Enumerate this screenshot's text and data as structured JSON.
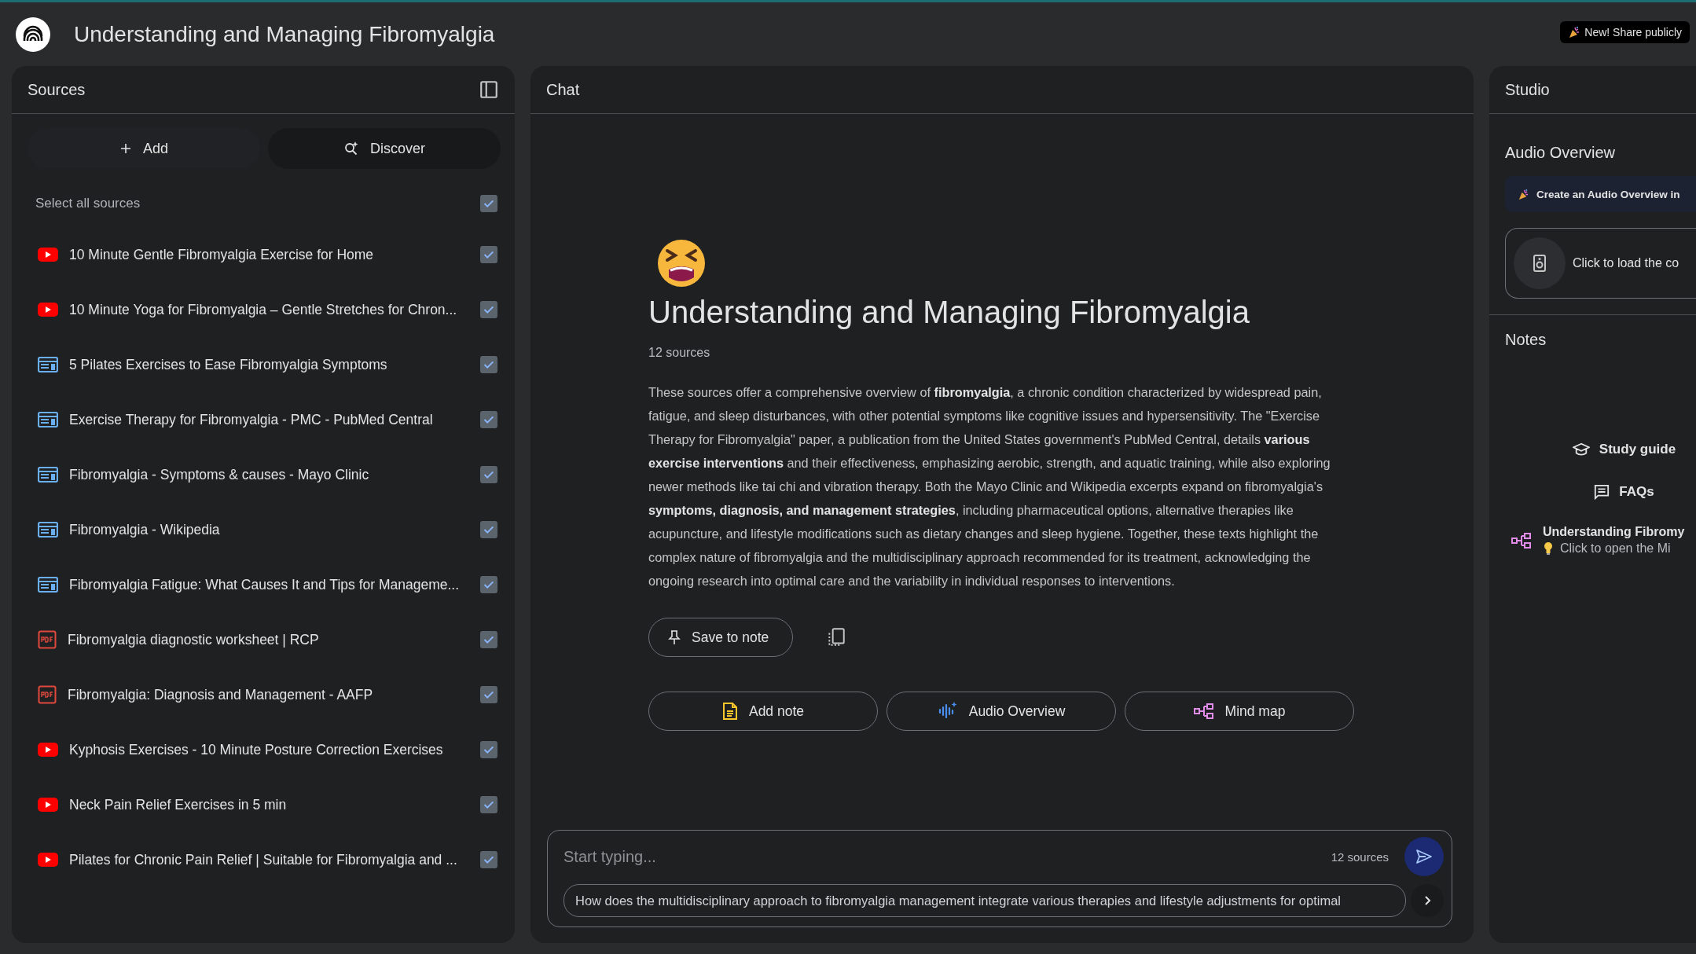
{
  "app": {
    "title": "Understanding and Managing Fibromyalgia",
    "share_button": "New! Share publicly"
  },
  "sources": {
    "title": "Sources",
    "add_button": "Add",
    "discover_button": "Discover",
    "select_all": {
      "label": "Select all sources",
      "checked": true
    },
    "items": [
      {
        "kind": "youtube",
        "title": "10 Minute Gentle Fibromyalgia Exercise for Home",
        "checked": true
      },
      {
        "kind": "youtube",
        "title": "10 Minute Yoga for Fibromyalgia – Gentle Stretches for Chron...",
        "checked": true
      },
      {
        "kind": "web",
        "title": "5 Pilates Exercises to Ease Fibromyalgia Symptoms",
        "checked": true
      },
      {
        "kind": "web",
        "title": "Exercise Therapy for Fibromyalgia - PMC - PubMed Central",
        "checked": true
      },
      {
        "kind": "web",
        "title": "Fibromyalgia - Symptoms & causes - Mayo Clinic",
        "checked": true
      },
      {
        "kind": "web",
        "title": "Fibromyalgia - Wikipedia",
        "checked": true
      },
      {
        "kind": "web",
        "title": "Fibromyalgia Fatigue: What Causes It and Tips for Manageme...",
        "checked": true
      },
      {
        "kind": "pdf",
        "title": "Fibromyalgia diagnostic worksheet | RCP",
        "checked": true
      },
      {
        "kind": "pdf",
        "title": "Fibromyalgia: Diagnosis and Management - AAFP",
        "checked": true
      },
      {
        "kind": "youtube",
        "title": "Kyphosis Exercises - 10 Minute Posture Correction Exercises",
        "checked": true
      },
      {
        "kind": "youtube",
        "title": "Neck Pain Relief Exercises in 5 min",
        "checked": true
      },
      {
        "kind": "youtube",
        "title": "Pilates for Chronic Pain Relief | Suitable for Fibromyalgia and ...",
        "checked": true
      }
    ]
  },
  "chat": {
    "title": "Chat",
    "notebook": {
      "title": "Understanding and Managing Fibromyalgia",
      "source_count": "12 sources",
      "summary": "These sources offer a comprehensive overview of **fibromyalgia**, a chronic condition characterized by widespread pain, fatigue, and sleep disturbances, with other potential symptoms like cognitive issues and hypersensitivity. The \"Exercise Therapy for Fibromyalgia\" paper, a publication from the United States government's PubMed Central, details **various exercise interventions** and their effectiveness, emphasizing aerobic, strength, and aquatic training, while also exploring newer methods like tai chi and vibration therapy. Both the Mayo Clinic and Wikipedia excerpts expand on fibromyalgia's **symptoms, diagnosis, and management strategies**, including pharmaceutical options, alternative therapies like acupuncture, and lifestyle modifications such as dietary changes and sleep hygiene. Together, these texts highlight the complex nature of fibromyalgia and the multidisciplinary approach recommended for its treatment, acknowledging the ongoing research into optimal care and the variability in individual responses to interventions."
    },
    "save_button": "Save to note",
    "actions": [
      {
        "kind": "note",
        "label": "Add note"
      },
      {
        "kind": "audio",
        "label": "Audio Overview"
      },
      {
        "kind": "mindmap",
        "label": "Mind map"
      }
    ],
    "input": {
      "placeholder": "Start typing...",
      "source_count": "12 sources",
      "suggestion": "How does the multidisciplinary approach to fibromyalgia management integrate various therapies and lifestyle adjustments for optimal"
    }
  },
  "studio": {
    "title": "Studio",
    "audio": {
      "title": "Audio Overview",
      "banner": "Create an Audio Overview in",
      "load_card": "Click to load the co"
    },
    "notes": {
      "title": "Notes",
      "actions": [
        {
          "kind": "study",
          "label": "Study guide"
        },
        {
          "kind": "faq",
          "label": "FAQs"
        }
      ],
      "items": [
        {
          "kind": "mindmap",
          "title": "Understanding Fibromy",
          "subtitle": "Click to open the Mi"
        }
      ]
    }
  }
}
